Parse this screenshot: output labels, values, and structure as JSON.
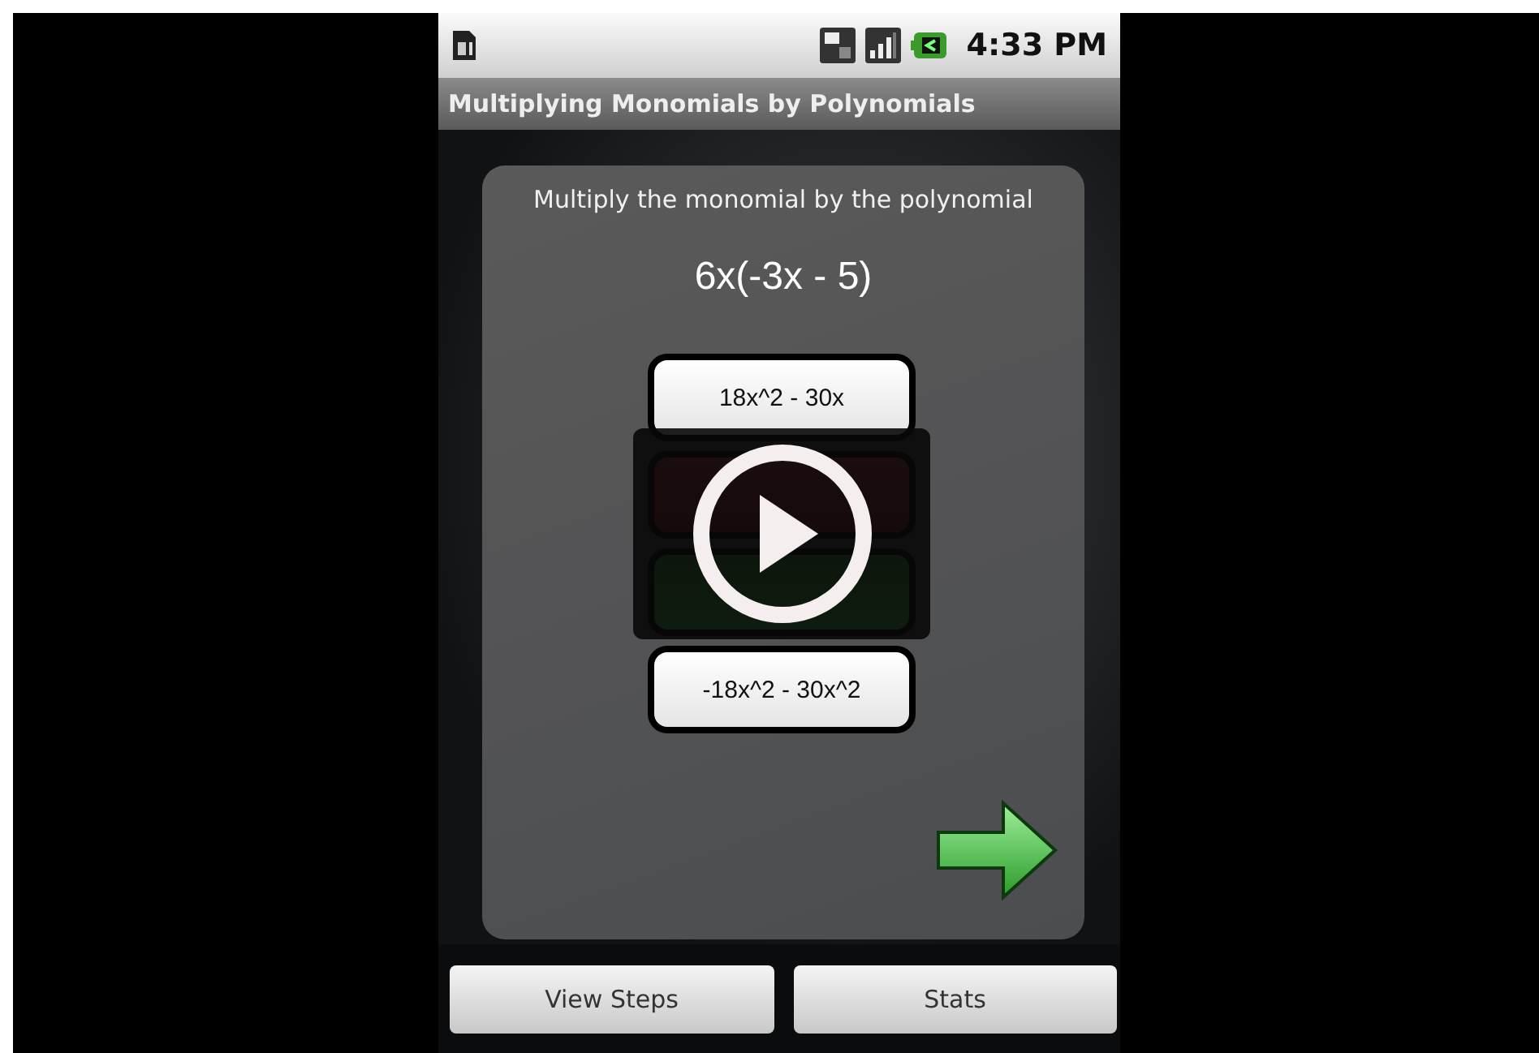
{
  "status_bar": {
    "time": "4:33 PM"
  },
  "title": "Multiplying Monomials by Polynomials",
  "question": {
    "instruction": "Multiply the monomial by the polynomial",
    "expression": "6x(-3x - 5)"
  },
  "answers": [
    {
      "kind": "plain",
      "text": "18x^2 - 30x"
    },
    {
      "kind": "wrong"
    },
    {
      "kind": "correct"
    },
    {
      "kind": "plain",
      "text": "-18x^2 - 30x^2"
    }
  ],
  "buttons": [
    "View Steps",
    "Stats"
  ]
}
